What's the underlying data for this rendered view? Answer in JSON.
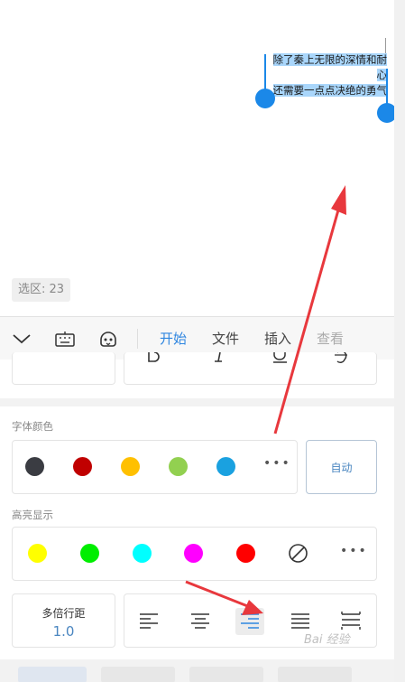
{
  "document": {
    "selected_lines": [
      "除了秦上无限的深情和耐心",
      "还需要一点点决绝的勇气"
    ]
  },
  "selection_info": "选区: 23",
  "toolbar": {
    "tabs": [
      "开始",
      "文件",
      "插入",
      "查看"
    ],
    "icons": [
      "collapse-chevron-icon",
      "keyboard-icon",
      "assistant-face-icon"
    ]
  },
  "font_color": {
    "title": "字体颜色",
    "swatches": [
      "#3a3c42",
      "#c00000",
      "#ffc000",
      "#92d050",
      "#1aa1e0"
    ],
    "auto_label": "自动"
  },
  "highlight": {
    "title": "高亮显示",
    "swatches": [
      "#ffff00",
      "#00ee00",
      "#00ffff",
      "#ff00ff",
      "#ff0000"
    ]
  },
  "line_spacing": {
    "label": "多倍行距",
    "value": "1.0"
  },
  "watermark": "Bai 经验",
  "colors": {
    "accent": "#2f86e0",
    "handle": "#1b88e8",
    "selection": "#a9d6fb",
    "annotation_arrow": "#e8383d"
  }
}
